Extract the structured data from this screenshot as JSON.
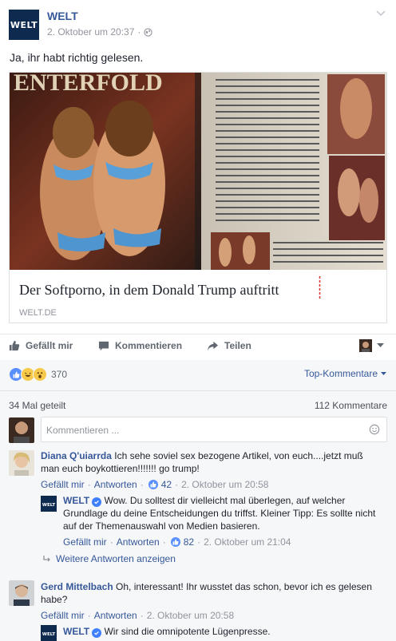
{
  "post": {
    "page_name": "WELT",
    "logo_text": "WELT",
    "date": "2. Oktober um 20:37",
    "separator": "·",
    "text": "Ja, ihr habt richtig gelesen."
  },
  "link": {
    "title": "Der Softporno, in dem Donald Trump auftritt",
    "domain": "WELT.DE"
  },
  "actions": {
    "like": "Gefällt mir",
    "comment": "Kommentieren",
    "share": "Teilen"
  },
  "stats": {
    "reaction_count": "370",
    "top_comments": "Top-Kommentare",
    "shares": "34 Mal geteilt",
    "comments": "112 Kommentare"
  },
  "composer": {
    "placeholder": "Kommentieren ..."
  },
  "comments": [
    {
      "author": "Diana Q'uiarrda",
      "text": "Ich sehe soviel sex bezogene Artikel, von euch....jetzt muß man euch boykottieren!!!!!!! go trump!",
      "like": "Gefällt mir",
      "reply": "Antworten",
      "likes": "42",
      "time": "2. Oktober um 20:58",
      "replies": [
        {
          "author": "WELT",
          "text": "Wow. Du solltest dir vielleicht mal überlegen, auf welcher Grundlage du deine Entscheidungen du triffst. Kleiner Tipp: Es sollte nicht auf der Themenauswahl von Medien basieren.",
          "like": "Gefällt mir",
          "reply": "Antworten",
          "likes": "82",
          "time": "2. Oktober um 21:04"
        }
      ],
      "more_replies": "Weitere Antworten anzeigen"
    },
    {
      "author": "Gerd Mittelbach",
      "text": "Oh, interessant! Ihr wusstet das schon, bevor ich es gelesen habe?",
      "like": "Gefällt mir",
      "reply": "Antworten",
      "time": "2. Oktober um 20:58",
      "replies": [
        {
          "author": "WELT",
          "text": "Wir sind die omnipotente Lügenpresse."
        }
      ]
    }
  ],
  "colors": {
    "link_blue": "#365899",
    "like_blue": "#5890ff",
    "welt_navy": "#0f2a4f"
  }
}
